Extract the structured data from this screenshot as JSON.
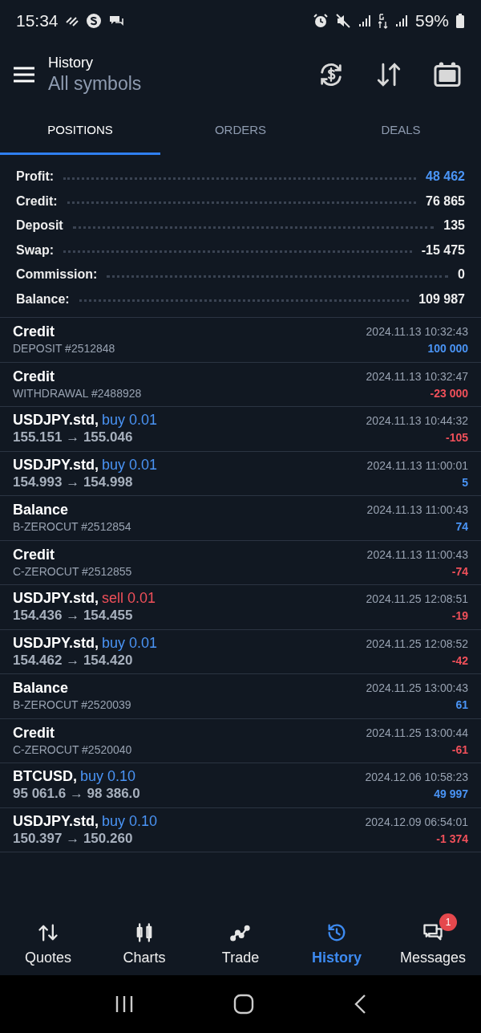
{
  "status_bar": {
    "time": "15:34",
    "battery": "59%"
  },
  "header": {
    "title": "History",
    "subtitle": "All symbols"
  },
  "tabs": [
    {
      "label": "POSITIONS",
      "selected": true
    },
    {
      "label": "ORDERS",
      "selected": false
    },
    {
      "label": "DEALS",
      "selected": false
    }
  ],
  "summary": [
    {
      "label": "Profit:",
      "value": "48 462",
      "highlight": true
    },
    {
      "label": "Credit:",
      "value": "76 865",
      "highlight": false
    },
    {
      "label": "Deposit",
      "value": "135",
      "highlight": false
    },
    {
      "label": "Swap:",
      "value": "-15 475",
      "highlight": false
    },
    {
      "label": "Commission:",
      "value": "0",
      "highlight": false
    },
    {
      "label": "Balance:",
      "value": "109 987",
      "highlight": false
    }
  ],
  "deals": [
    {
      "kind": "transfer",
      "title": "Credit",
      "detail": "DEPOSIT #2512848",
      "time": "2024.11.13 10:32:43",
      "amount": "100 000",
      "positive": true
    },
    {
      "kind": "transfer",
      "title": "Credit",
      "detail": "WITHDRAWAL #2488928",
      "time": "2024.11.13 10:32:47",
      "amount": "-23 000",
      "positive": false
    },
    {
      "kind": "trade",
      "title": "USDJPY.std,",
      "action": "buy 0.01",
      "sell": false,
      "detail": "155.151 → 155.046",
      "time": "2024.11.13 10:44:32",
      "amount": "-105",
      "positive": false
    },
    {
      "kind": "trade",
      "title": "USDJPY.std,",
      "action": "buy 0.01",
      "sell": false,
      "detail": "154.993 → 154.998",
      "time": "2024.11.13 11:00:01",
      "amount": "5",
      "positive": true
    },
    {
      "kind": "transfer",
      "title": "Balance",
      "detail": "B-ZEROCUT #2512854",
      "time": "2024.11.13 11:00:43",
      "amount": "74",
      "positive": true
    },
    {
      "kind": "transfer",
      "title": "Credit",
      "detail": "C-ZEROCUT #2512855",
      "time": "2024.11.13 11:00:43",
      "amount": "-74",
      "positive": false
    },
    {
      "kind": "trade",
      "title": "USDJPY.std,",
      "action": "sell 0.01",
      "sell": true,
      "detail": "154.436 → 154.455",
      "time": "2024.11.25 12:08:51",
      "amount": "-19",
      "positive": false
    },
    {
      "kind": "trade",
      "title": "USDJPY.std,",
      "action": "buy 0.01",
      "sell": false,
      "detail": "154.462 → 154.420",
      "time": "2024.11.25 12:08:52",
      "amount": "-42",
      "positive": false
    },
    {
      "kind": "transfer",
      "title": "Balance",
      "detail": "B-ZEROCUT #2520039",
      "time": "2024.11.25 13:00:43",
      "amount": "61",
      "positive": true
    },
    {
      "kind": "transfer",
      "title": "Credit",
      "detail": "C-ZEROCUT #2520040",
      "time": "2024.11.25 13:00:44",
      "amount": "-61",
      "positive": false
    },
    {
      "kind": "trade",
      "title": "BTCUSD,",
      "action": "buy 0.10",
      "sell": false,
      "detail": "95 061.6 → 98 386.0",
      "time": "2024.12.06 10:58:23",
      "amount": "49 997",
      "positive": true
    },
    {
      "kind": "trade",
      "title": "USDJPY.std,",
      "action": "buy 0.10",
      "sell": false,
      "detail": "150.397 → 150.260",
      "time": "2024.12.09 06:54:01",
      "amount": "-1 374",
      "positive": false
    }
  ],
  "bottom_nav": [
    {
      "kind": "quotes",
      "label": "Quotes",
      "selected": false
    },
    {
      "kind": "charts",
      "label": "Charts",
      "selected": false
    },
    {
      "kind": "trade",
      "label": "Trade",
      "selected": false
    },
    {
      "kind": "history",
      "label": "History",
      "selected": true
    },
    {
      "kind": "messages",
      "label": "Messages",
      "selected": false,
      "badge": "1"
    }
  ]
}
